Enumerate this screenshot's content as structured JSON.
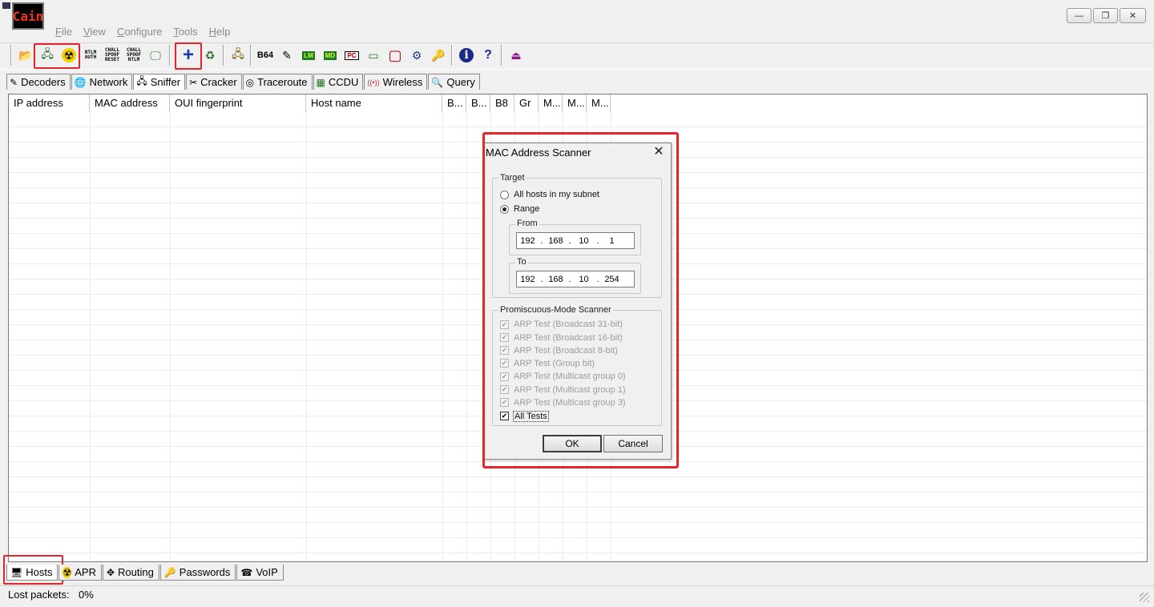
{
  "app": {
    "logo_text": "Cain",
    "window_buttons": {
      "minimize": "—",
      "restore": "❐",
      "close": "✕"
    }
  },
  "menu": [
    {
      "label": "File",
      "hotkey": "F",
      "rest": "ile"
    },
    {
      "label": "View",
      "hotkey": "V",
      "rest": "iew"
    },
    {
      "label": "Configure",
      "hotkey": "C",
      "rest": "onfigure"
    },
    {
      "label": "Tools",
      "hotkey": "T",
      "rest": "ools"
    },
    {
      "label": "Help",
      "hotkey": "H",
      "rest": "elp"
    }
  ],
  "toolbar": {
    "open": "📂",
    "sniffer": "🖧",
    "apr": "☢",
    "ntlm_auth": "NTLM\nAUTH",
    "chall_reset": "CHALL\nSPOOF\nRESET",
    "chall_ntlm": "CHALL\nSPOOF\nNTLM",
    "monitor": "🖵",
    "add": "+",
    "recycle": "♻",
    "b64": "B64",
    "decode": "✎",
    "lm": "LM",
    "md": "MD",
    "pc": "PC",
    "tb1": "▭",
    "tb2": "▢",
    "globe": "⚙",
    "key": "🔑",
    "info": "i",
    "help": "?",
    "exit": "⏏"
  },
  "top_tabs": [
    {
      "label": "Decoders",
      "icon": "✎"
    },
    {
      "label": "Network",
      "icon": "🌐"
    },
    {
      "label": "Sniffer",
      "icon": "🖧"
    },
    {
      "label": "Cracker",
      "icon": "✂"
    },
    {
      "label": "Traceroute",
      "icon": "◎"
    },
    {
      "label": "CCDU",
      "icon": "▦"
    },
    {
      "label": "Wireless",
      "icon": "((•))"
    },
    {
      "label": "Query",
      "icon": "🔍"
    }
  ],
  "columns": [
    "IP address",
    "MAC address",
    "OUI fingerprint",
    "Host name",
    "B...",
    "B...",
    "B8",
    "Gr",
    "M...",
    "M...",
    "M..."
  ],
  "bottom_tabs": [
    {
      "label": "Hosts",
      "icon": "🖥"
    },
    {
      "label": "APR",
      "icon": "☢"
    },
    {
      "label": "Routing",
      "icon": "✥"
    },
    {
      "label": "Passwords",
      "icon": "🔑"
    },
    {
      "label": "VoIP",
      "icon": "☎"
    }
  ],
  "status": {
    "label": "Lost packets:",
    "value": "0%"
  },
  "dialog": {
    "title": "MAC Address Scanner",
    "close": "✕",
    "target": {
      "legend": "Target",
      "option_all": "All hosts in my subnet",
      "option_range": "Range",
      "selected": "Range",
      "from_label": "From",
      "to_label": "To",
      "from": [
        "192",
        "168",
        "10",
        "1"
      ],
      "to": [
        "192",
        "168",
        "10",
        "254"
      ],
      "dot": "."
    },
    "promisc": {
      "legend": "Promiscuous-Mode Scanner",
      "tests": [
        {
          "label": "ARP Test (Broadcast 31-bit)",
          "checked": true,
          "enabled": false
        },
        {
          "label": "ARP Test (Broadcast 16-bit)",
          "checked": true,
          "enabled": false
        },
        {
          "label": "ARP Test (Broadcast 8-bit)",
          "checked": true,
          "enabled": false
        },
        {
          "label": "ARP Test (Group bit)",
          "checked": true,
          "enabled": false
        },
        {
          "label": "ARP Test (Multicast group 0)",
          "checked": true,
          "enabled": false
        },
        {
          "label": "ARP Test (Multicast group 1)",
          "checked": true,
          "enabled": false
        },
        {
          "label": "ARP Test (Multicast group 3)",
          "checked": true,
          "enabled": false
        },
        {
          "label": "All Tests",
          "checked": true,
          "enabled": true
        }
      ],
      "check_mark": "✔"
    },
    "ok": "OK",
    "cancel": "Cancel"
  }
}
